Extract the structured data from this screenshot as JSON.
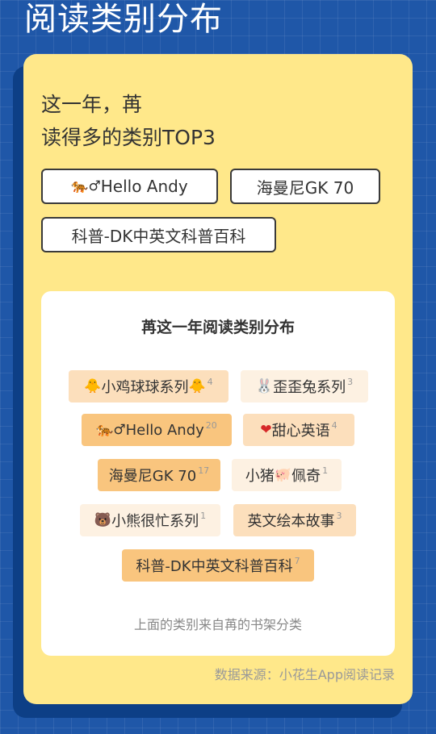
{
  "page": {
    "title": "阅读类别分布"
  },
  "card": {
    "headline_line1": "这一年，苒",
    "headline_line2": "读得多的类别TOP3",
    "top3": [
      {
        "emoji": "🐅♂",
        "label": "Hello Andy"
      },
      {
        "label": "海曼尼GK 70"
      },
      {
        "label": "科普-DK中英文科普百科"
      }
    ]
  },
  "panel": {
    "title": "苒这一年阅读类别分布",
    "tags": [
      {
        "prefix": "🐥",
        "label": "小鸡球球系列",
        "suffix": "🐥",
        "count": "4"
      },
      {
        "prefix": "🐰",
        "label": "歪歪兔系列",
        "suffix": "",
        "count": "3"
      },
      {
        "prefix": "🐅♂",
        "label": "Hello Andy",
        "suffix": "",
        "count": "20"
      },
      {
        "prefix": "❤",
        "label": "甜心英语",
        "suffix": "",
        "count": "4"
      },
      {
        "prefix": "",
        "label": "海曼尼GK 70",
        "suffix": "",
        "count": "17"
      },
      {
        "prefix": "",
        "label": "小猪",
        "mid": "🐖",
        "label2": "佩奇",
        "suffix": "",
        "count": "1"
      },
      {
        "prefix": "🐻",
        "label": "小熊很忙系列",
        "suffix": "",
        "count": "1"
      },
      {
        "prefix": "",
        "label": "英文绘本故事",
        "suffix": "",
        "count": "3"
      },
      {
        "prefix": "",
        "label": "科普-DK中英文科普百科",
        "suffix": "",
        "count": "7"
      }
    ],
    "footnote": "上面的类别来自苒的书架分类"
  },
  "source": "数据来源：小花生App阅读记录",
  "colors": {
    "background": "#1f57a8",
    "card": "#ffe88a",
    "tag_strong": "#f9c57e",
    "tag_mid": "#fcdfbc",
    "tag_light": "#fdf1e2"
  }
}
